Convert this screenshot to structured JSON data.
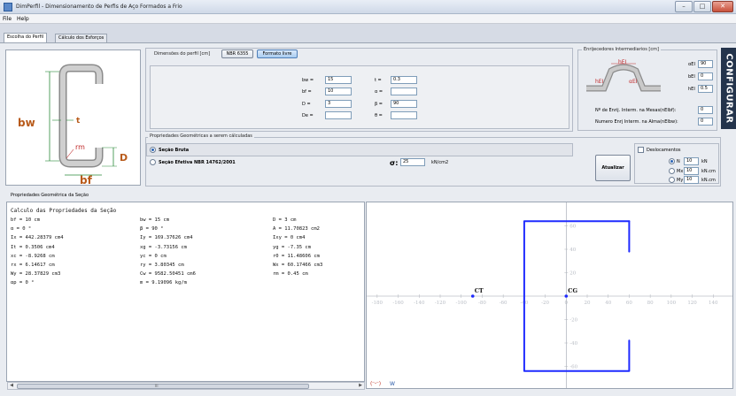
{
  "window": {
    "title": "DimPerfil - Dimensionamento de Perfis de Aço Formados a Frio"
  },
  "menu": [
    "File",
    "Help"
  ],
  "tabs": [
    {
      "label": "Escolha do Perfil",
      "active": true
    },
    {
      "label": "Cálculo dos Esforços",
      "active": false
    }
  ],
  "diagram": {
    "labels": {
      "bw": "bw",
      "bf": "bf",
      "D": "D",
      "t": "t",
      "rm": "rm"
    }
  },
  "dimensions": {
    "legend": "Dimensões do perfil [cm]",
    "btn_norm": "NBR 6355",
    "btn_free": "Formato livre",
    "fields": {
      "bw": {
        "label": "bw =",
        "value": "15"
      },
      "bf": {
        "label": "bf =",
        "value": "10"
      },
      "D": {
        "label": "D =",
        "value": "3"
      },
      "De": {
        "label": "De =",
        "value": ""
      },
      "t": {
        "label": "t =",
        "value": "0.3"
      },
      "alpha": {
        "label": "α =",
        "value": ""
      },
      "beta": {
        "label": "β =",
        "value": "90"
      },
      "theta": {
        "label": "θ =",
        "value": ""
      }
    }
  },
  "stiffeners": {
    "legend": "Enrijecedores Intermediarios [cm]",
    "fig": {
      "top": "hEI",
      "left": "hEI",
      "right": "αEI"
    },
    "fields": [
      {
        "label": "αEI",
        "value": "90"
      },
      {
        "label": "bEI",
        "value": "0"
      },
      {
        "label": "hEI",
        "value": "0.5"
      },
      {
        "label": "Nº de Enrij. Interm. na Mesas(nEIbf):",
        "value": "0"
      },
      {
        "label": "Numero Enrj Interm. na Alma(nEIbw):",
        "value": "0"
      }
    ],
    "side_button": "CONFIGURAR"
  },
  "properties": {
    "legend": "Propriedades Geométricas a serem cálculadas",
    "opt_gross": "Seção Bruta",
    "opt_effective": "Seção Efetiva NBR 14762/2001",
    "sigma_label": "σ:",
    "sigma_value": "25",
    "sigma_unit": "kN/cm2",
    "displacements": {
      "label": "Deslocamentos",
      "rows": [
        {
          "label": "N",
          "value": "10",
          "unit": "kN",
          "selected": true
        },
        {
          "label": "Mx",
          "value": "10",
          "unit": "kN.cm",
          "selected": false
        },
        {
          "label": "My",
          "value": "10",
          "unit": "kN.cm",
          "selected": false
        }
      ]
    },
    "update_button": "Atualizar"
  },
  "results": {
    "section_title": "Propriedades Geométrica da Seção",
    "heading": "Calculo das Propriedades da Seção",
    "columns": [
      [
        "bf = 10 cm",
        "α = 0 °",
        "Ix = 442.28379 cm4",
        "It = 0.3506 cm4",
        "xc = -8.9268 cm",
        "rx = 6.14617 cm",
        "Wy = 28.37829 cm3",
        "αp = 0 °"
      ],
      [
        "bw = 15 cm",
        "β = 90 °",
        "Iy = 169.37626 cm4",
        "xg = -3.73156 cm",
        "yc = 0 cm",
        "ry = 3.80345 cm",
        "Cw = 9582.50451 cm6",
        "m = 9.19096 kg/m"
      ],
      [
        "D = 3 cm",
        "A = 11.70823 cm2",
        "Ixy = 0 cm4",
        "yg = -7.35 cm",
        "r0 = 11.48606 cm",
        "Wx = 60.17466 cm3",
        "rm = 0.45 cm",
        ""
      ]
    ],
    "scroll_label": "III"
  },
  "chart_data": {
    "type": "line",
    "title": "",
    "xlabel": "",
    "ylabel": "",
    "xlim": [
      -190,
      160
    ],
    "ylim": [
      -80,
      80
    ],
    "x_ticks": [
      -180,
      -160,
      -140,
      -120,
      -100,
      -80,
      -60,
      -40,
      -20,
      0,
      20,
      40,
      60,
      80,
      100,
      120,
      140
    ],
    "y_ticks": [
      60,
      40,
      20,
      -20,
      -40,
      -60
    ],
    "series": [
      {
        "points": [
          [
            60,
            64
          ],
          [
            -40,
            64
          ],
          [
            -40,
            -64
          ],
          [
            60,
            -64
          ],
          [
            60,
            -38
          ]
        ]
      },
      {
        "points": [
          [
            60,
            64
          ],
          [
            60,
            38
          ]
        ]
      }
    ],
    "points": [
      {
        "label": "CT",
        "x": -89,
        "y": 0
      },
      {
        "label": "CG",
        "x": 0,
        "y": 0
      }
    ],
    "footer_icon_text": "W",
    "accent_color": "#1f2bff"
  }
}
